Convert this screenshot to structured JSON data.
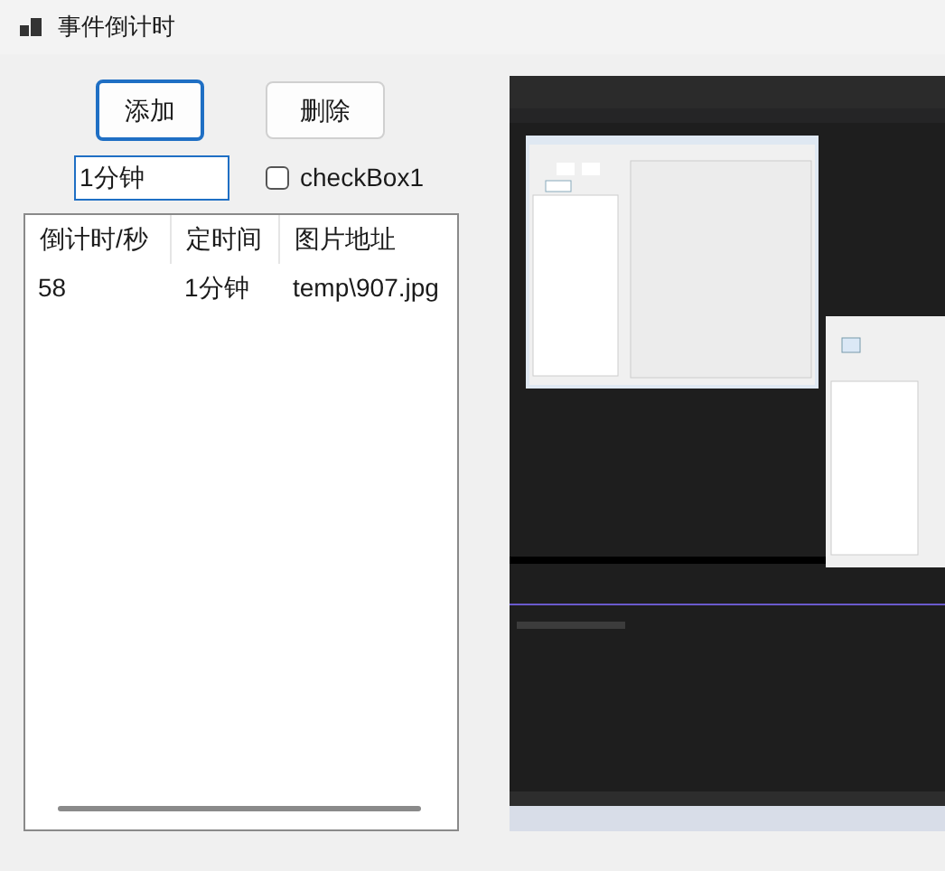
{
  "window": {
    "title": "事件倒计时"
  },
  "buttons": [
    {
      "label": "添加",
      "focused": true
    },
    {
      "label": "删除",
      "focused": false
    }
  ],
  "time_field": {
    "value": "1分钟"
  },
  "checkbox": {
    "label": "checkBox1",
    "checked": false
  },
  "list": {
    "columns": [
      "倒计时/秒",
      "定时间",
      "图片地址"
    ],
    "rows": [
      [
        "58",
        "1分钟",
        "temp\\907.jpg"
      ]
    ]
  }
}
